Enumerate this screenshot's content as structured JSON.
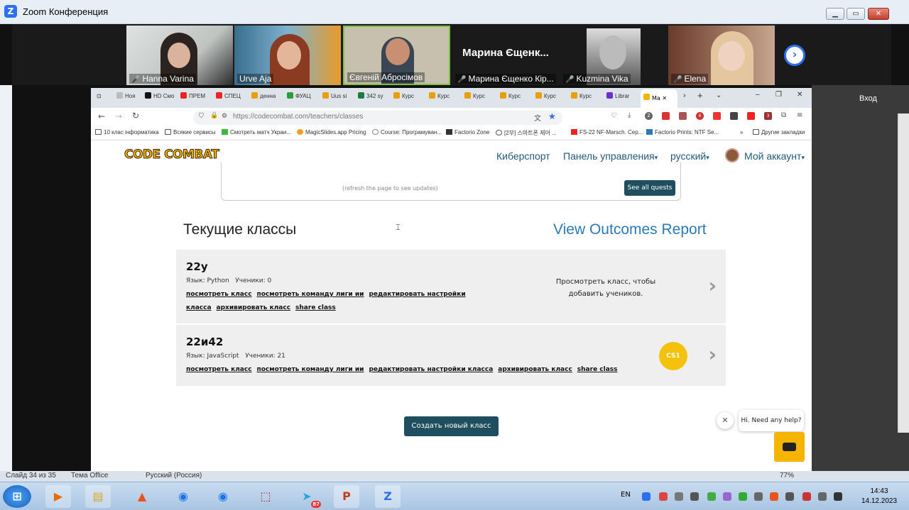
{
  "zoom": {
    "title": "Zoom Конференция",
    "participants": [
      {
        "name": "Hanna Varina",
        "muted": true
      },
      {
        "name": "Urve Aja",
        "muted": false
      },
      {
        "name": "Євгеній Абросімов",
        "muted": false
      },
      {
        "name": "Марина Єщенко Кір...",
        "muted": true,
        "big_name": "Марина Єщенк..."
      },
      {
        "name": "Kuzmina Vika",
        "muted": true
      },
      {
        "name": "Elena",
        "muted": true
      }
    ],
    "side_label": "Вход"
  },
  "browser": {
    "tabs": [
      "Ноя",
      "HD Смо",
      "ПРЕМ",
      "СПЕЦ",
      "денна",
      "ФУАЦ",
      "Uus si",
      "342 sy",
      "Курс",
      "Курс",
      "Курс",
      "Курс",
      "Курс",
      "Курс",
      "Librar"
    ],
    "active_tab": "Ma",
    "url": "https://codecombat.com/teachers/classes",
    "bookmarks": [
      "10 клас інформатика",
      "Всякие сервисы",
      "Смотреть матч Украи...",
      "MagicSlides.app Pricing",
      "Course: Програмуван...",
      "Factorio Zone",
      "[2부] 스마트폰 제어 ...",
      "FS-22 NF-Marsch. Cep...",
      "Factorio Prints: NTF Se..."
    ],
    "other_bookmarks": "Другие закладки",
    "badges": [
      "2",
      "6",
      "3"
    ]
  },
  "site": {
    "logo": "CODE COMBAT",
    "nav": {
      "esports": "Киберспорт",
      "dashboard": "Панель управления",
      "language": "русский",
      "account": "Мой аккаунт"
    },
    "quest_refresh": "(refresh the page to see updates)",
    "see_all_quests": "See all quests",
    "current_classes": "Текущие классы",
    "outcomes_report": "View Outcomes Report",
    "classes": [
      {
        "name": "22у",
        "language": "Язык: Python",
        "students": "Ученики: 0",
        "links": [
          "посмотреть класс",
          "посмотреть команду лиги ии",
          "редактировать настройки класса",
          "архивировать класс",
          "share class"
        ],
        "message": "Просмотреть класс, чтобы добавить учеников."
      },
      {
        "name": "22и42",
        "language": "Язык: JavaScript",
        "students": "Ученики: 21",
        "links": [
          "посмотреть класс",
          "посмотреть команду лиги ии",
          "редактировать настройки класса",
          "архивировать класс",
          "share class"
        ],
        "course_badge": "CS1"
      }
    ],
    "create_class": "Создать новый класс",
    "help_text": "Hi. Need any help?"
  },
  "ppt_status": {
    "slide": "Слайд 34 из 35",
    "theme": "Тема Office",
    "language": "Русский (Россия)",
    "zoom": "77%"
  },
  "taskbar": {
    "lang": "EN",
    "time": "14:43",
    "date": "14.12.2023",
    "telegram_badge": "87"
  }
}
